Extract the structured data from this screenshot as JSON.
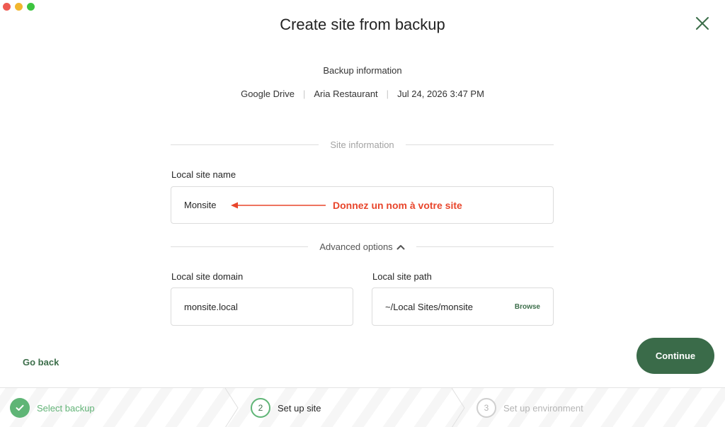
{
  "window": {
    "title": "Create site from backup"
  },
  "backup": {
    "label": "Backup information",
    "provider": "Google Drive",
    "site": "Aria Restaurant",
    "date": "Jul 24, 2026 3:47 PM"
  },
  "site_info": {
    "section_label": "Site information",
    "name_label": "Local site name",
    "name_value": "Monsite"
  },
  "annotation": {
    "text": "Donnez un nom à votre site",
    "color": "#e8462c"
  },
  "advanced": {
    "label": "Advanced options",
    "expanded": true,
    "domain_label": "Local site domain",
    "domain_value": "monsite.local",
    "path_label": "Local site path",
    "path_value": "~/Local Sites/monsite",
    "browse_label": "Browse"
  },
  "actions": {
    "go_back": "Go back",
    "continue": "Continue"
  },
  "steps": [
    {
      "number": "1",
      "label": "Select backup",
      "state": "complete"
    },
    {
      "number": "2",
      "label": "Set up site",
      "state": "active"
    },
    {
      "number": "3",
      "label": "Set up environment",
      "state": "upcoming"
    }
  ],
  "colors": {
    "brand_green": "#3a6b49",
    "step_complete": "#5fb576",
    "annotation_red": "#e8462c"
  }
}
